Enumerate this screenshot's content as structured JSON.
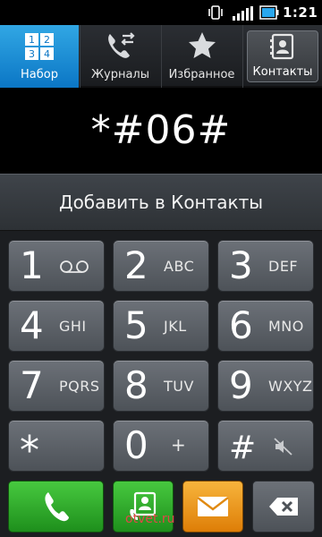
{
  "status_bar": {
    "time": "1:21",
    "icons": [
      "vibrate-icon",
      "signal-icon",
      "battery-icon"
    ]
  },
  "tabs": [
    {
      "label": "Набор",
      "icon": "dialpad-grid-icon",
      "active": true
    },
    {
      "label": "Журналы",
      "icon": "call-log-icon",
      "active": false
    },
    {
      "label": "Избранное",
      "icon": "star-icon",
      "active": false
    },
    {
      "label": "Контакты",
      "icon": "contacts-card-icon",
      "active": false
    }
  ],
  "dialpad_grid_icon_digits": [
    "1",
    "2",
    "3",
    "4"
  ],
  "display": {
    "number": "*#06#"
  },
  "add_contact": {
    "label": "Добавить в Контакты"
  },
  "keys": [
    {
      "digit": "1",
      "letters": "",
      "sub_icon": "voicemail-icon"
    },
    {
      "digit": "2",
      "letters": "ABC"
    },
    {
      "digit": "3",
      "letters": "DEF"
    },
    {
      "digit": "4",
      "letters": "GHI"
    },
    {
      "digit": "5",
      "letters": "JKL"
    },
    {
      "digit": "6",
      "letters": "MNO"
    },
    {
      "digit": "7",
      "letters": "PQRS"
    },
    {
      "digit": "8",
      "letters": "TUV"
    },
    {
      "digit": "9",
      "letters": "WXYZ"
    },
    {
      "digit": "*",
      "letters": ""
    },
    {
      "digit": "0",
      "letters": "+"
    },
    {
      "digit": "#",
      "letters": "",
      "sub_icon": "mute-icon"
    }
  ],
  "bottom_buttons": [
    {
      "name": "call-button",
      "icon": "phone-icon"
    },
    {
      "name": "add-contact-button",
      "icon": "contact-add-icon"
    },
    {
      "name": "message-button",
      "icon": "envelope-icon"
    },
    {
      "name": "backspace-button",
      "icon": "backspace-icon"
    }
  ],
  "watermark": "otvet.ru",
  "colors": {
    "active_tab": "#1e8fd6",
    "call_green": "#2ba72a",
    "message_orange": "#ec9a1c",
    "key_gray": "#5c6168"
  }
}
